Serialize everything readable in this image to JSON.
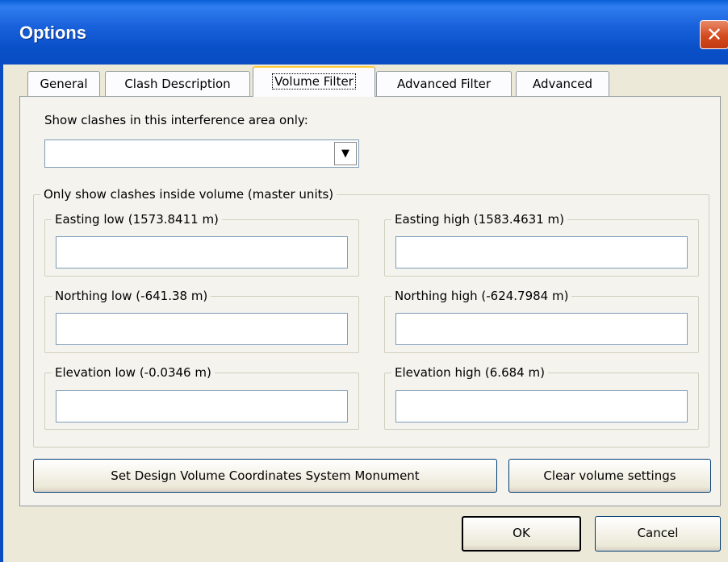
{
  "window": {
    "title": "Options",
    "close_glyph": "✕",
    "close_icon": "close-icon"
  },
  "tabs": [
    {
      "label": "General",
      "active": false
    },
    {
      "label": "Clash Description",
      "active": false
    },
    {
      "label": "Volume Filter",
      "active": true
    },
    {
      "label": "Advanced Filter",
      "active": false
    },
    {
      "label": "Advanced",
      "active": false
    }
  ],
  "volume_filter": {
    "area_label": "Show clashes in this interference area only:",
    "area_value": "",
    "dropdown_glyph": "▼",
    "dropdown_icon": "chevron-down-icon",
    "volume_group_label": "Only show clashes inside volume (master units)",
    "easting_low": {
      "label": "Easting low (1573.8411 m)",
      "value": ""
    },
    "easting_high": {
      "label": "Easting high (1583.4631 m)",
      "value": ""
    },
    "northing_low": {
      "label": "Northing low (-641.38 m)",
      "value": ""
    },
    "northing_high": {
      "label": "Northing high (-624.7984 m)",
      "value": ""
    },
    "elevation_low": {
      "label": "Elevation low (-0.0346 m)",
      "value": ""
    },
    "elevation_high": {
      "label": "Elevation high (6.684 m)",
      "value": ""
    },
    "set_monument_label": "Set Design Volume Coordinates System Monument",
    "clear_label": "Clear volume settings"
  },
  "footer": {
    "ok_label": "OK",
    "cancel_label": "Cancel"
  },
  "colors": {
    "titlebar": "#0a4cc2",
    "close_button": "#d44a1e",
    "dialog_bg": "#ece9d8",
    "active_tab_accent": "#ffc83c"
  }
}
